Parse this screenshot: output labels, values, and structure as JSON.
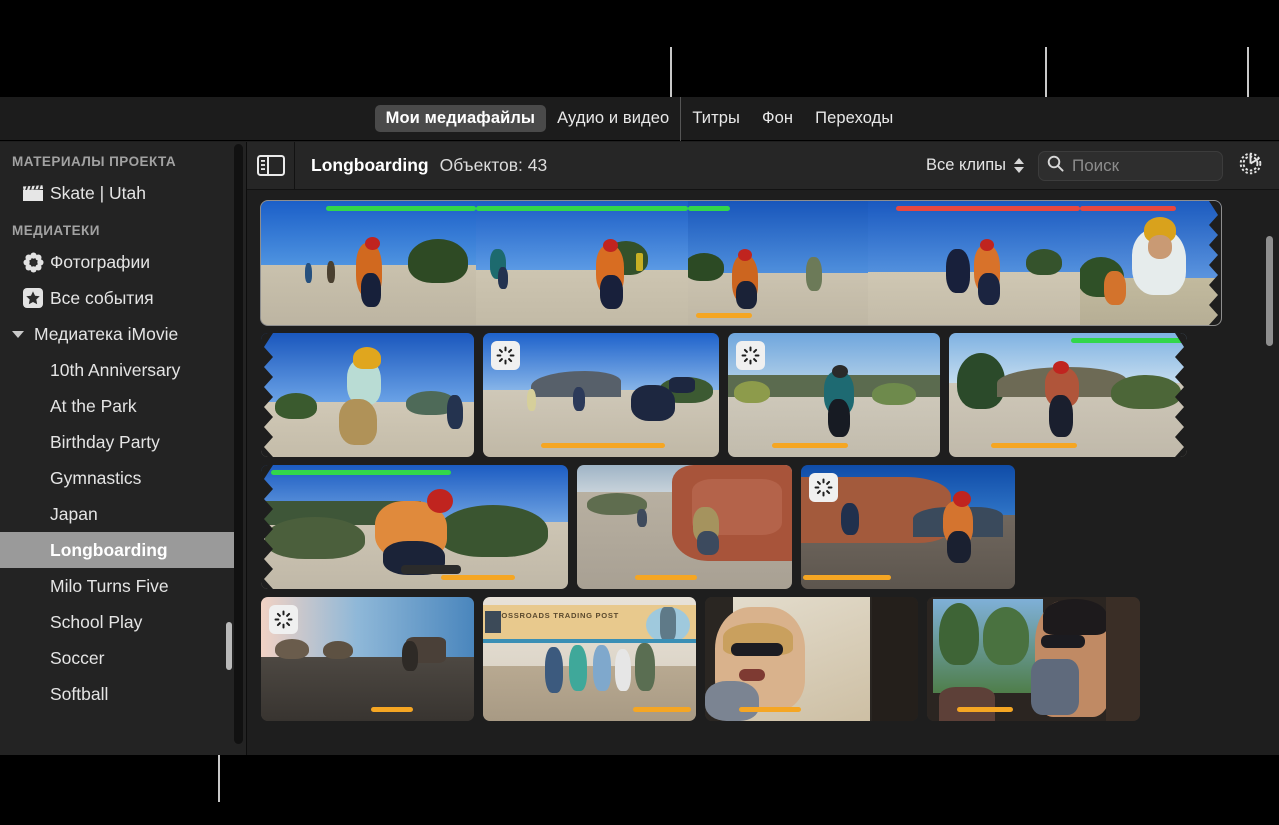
{
  "app": "iMovie",
  "colors": {
    "window_bg": "#1e1e1e",
    "sidebar_bg": "#232323",
    "header_bg": "#262626",
    "selection": "#9a9a9a",
    "tab_selected": "#4a4a4a",
    "favorite_green": "#32d74b",
    "rejected_red": "#e8473f",
    "used_orange": "#f5a623",
    "callout_line": "#c8c8c8"
  },
  "tabbar": {
    "tabs": [
      {
        "label": "Мои медиафайлы",
        "selected": true
      },
      {
        "label": "Аудио и видео",
        "selected": false
      },
      {
        "label": "Титры",
        "selected": false
      },
      {
        "label": "Фон",
        "selected": false
      },
      {
        "label": "Переходы",
        "selected": false
      }
    ]
  },
  "sidebar": {
    "sections": [
      {
        "title": "МАТЕРИАЛЫ ПРОЕКТА",
        "items": [
          {
            "label": "Skate | Utah",
            "icon": "clapperboard-icon",
            "selected": false,
            "indent": "icon"
          }
        ]
      },
      {
        "title": "МЕДИАТЕКИ",
        "items": [
          {
            "label": "Фотографии",
            "icon": "photos-flower-icon",
            "selected": false,
            "indent": "icon"
          },
          {
            "label": "Все события",
            "icon": "star-icon",
            "selected": false,
            "indent": "icon"
          },
          {
            "label": "Медиатека iMovie",
            "icon": "disclosure-triangle-icon",
            "selected": false,
            "indent": "disclosure"
          },
          {
            "label": "10th Anniversary",
            "icon": "",
            "selected": false,
            "indent": "child"
          },
          {
            "label": "At the Park",
            "icon": "",
            "selected": false,
            "indent": "child"
          },
          {
            "label": "Birthday Party",
            "icon": "",
            "selected": false,
            "indent": "child"
          },
          {
            "label": "Gymnastics",
            "icon": "",
            "selected": false,
            "indent": "child"
          },
          {
            "label": "Japan",
            "icon": "",
            "selected": false,
            "indent": "child"
          },
          {
            "label": "Longboarding",
            "icon": "",
            "selected": true,
            "indent": "child"
          },
          {
            "label": "Milo Turns Five",
            "icon": "",
            "selected": false,
            "indent": "child"
          },
          {
            "label": "School Play",
            "icon": "",
            "selected": false,
            "indent": "child"
          },
          {
            "label": "Soccer",
            "icon": "",
            "selected": false,
            "indent": "child"
          },
          {
            "label": "Softball",
            "icon": "",
            "selected": false,
            "indent": "child"
          }
        ]
      }
    ]
  },
  "browser": {
    "sidebar_toggle_icon": "sidebar-toggle-icon",
    "title": "Longboarding",
    "count_label": "Объектов: 43",
    "filter_label": "Все клипы",
    "search": {
      "placeholder": "Поиск",
      "value": "",
      "icon": "search-icon"
    },
    "settings_icon": "gear-icon"
  },
  "grid": {
    "rows": [
      {
        "type": "filmstrip",
        "selected": true,
        "frames": [
          {
            "scene": "skater-orange-shirt-wide"
          },
          {
            "scene": "skater-two-riders-road"
          },
          {
            "scene": "skater-crouch-yellow-sign"
          },
          {
            "scene": "skater-pair-downhill"
          },
          {
            "scene": "skater-yellow-helmet-close"
          }
        ],
        "markers": [
          {
            "kind": "green",
            "label": "favorite"
          },
          {
            "kind": "green",
            "label": "favorite"
          },
          {
            "kind": "red",
            "label": "rejected"
          },
          {
            "kind": "orange",
            "label": "used-in-project"
          }
        ]
      },
      {
        "type": "clips",
        "clips": [
          {
            "scene": "skater-teal-shirt-stretch",
            "badge": null,
            "markers": []
          },
          {
            "scene": "skater-mountain-crouch",
            "badge": "analyzing-icon",
            "markers": [
              {
                "kind": "orange"
              }
            ]
          },
          {
            "scene": "skater-girl-ridge",
            "badge": "analyzing-icon",
            "markers": [
              {
                "kind": "orange"
              }
            ]
          },
          {
            "scene": "skater-red-helmet-hill",
            "badge": null,
            "markers": [
              {
                "kind": "green"
              },
              {
                "kind": "orange"
              }
            ]
          }
        ]
      },
      {
        "type": "clips",
        "clips": [
          {
            "scene": "skater-orange-shirt-carve",
            "badge": null,
            "markers": [
              {
                "kind": "green"
              },
              {
                "kind": "orange"
              }
            ]
          },
          {
            "scene": "skater-red-rock-cliff",
            "badge": null,
            "markers": [
              {
                "kind": "orange"
              }
            ]
          },
          {
            "scene": "skater-canyon-two",
            "badge": "analyzing-icon",
            "markers": [
              {
                "kind": "orange"
              }
            ]
          }
        ]
      },
      {
        "type": "clips",
        "clips": [
          {
            "scene": "empty-road-sunset",
            "badge": "analyzing-icon",
            "markers": [
              {
                "kind": "orange"
              }
            ]
          },
          {
            "scene": "crossroads-trading-post-group",
            "badge": null,
            "markers": [
              {
                "kind": "orange"
              }
            ],
            "sign_text": "CROSSROADS TRADING POST"
          },
          {
            "scene": "van-man-sunglasses",
            "badge": null,
            "markers": [
              {
                "kind": "orange"
              }
            ]
          },
          {
            "scene": "van-woman-sunglasses",
            "badge": null,
            "markers": [
              {
                "kind": "orange"
              }
            ]
          }
        ]
      }
    ]
  },
  "callouts": [
    {
      "name": "callout-filter-popup"
    },
    {
      "name": "callout-search-field"
    },
    {
      "name": "callout-settings-button"
    },
    {
      "name": "callout-selected-event"
    }
  ]
}
